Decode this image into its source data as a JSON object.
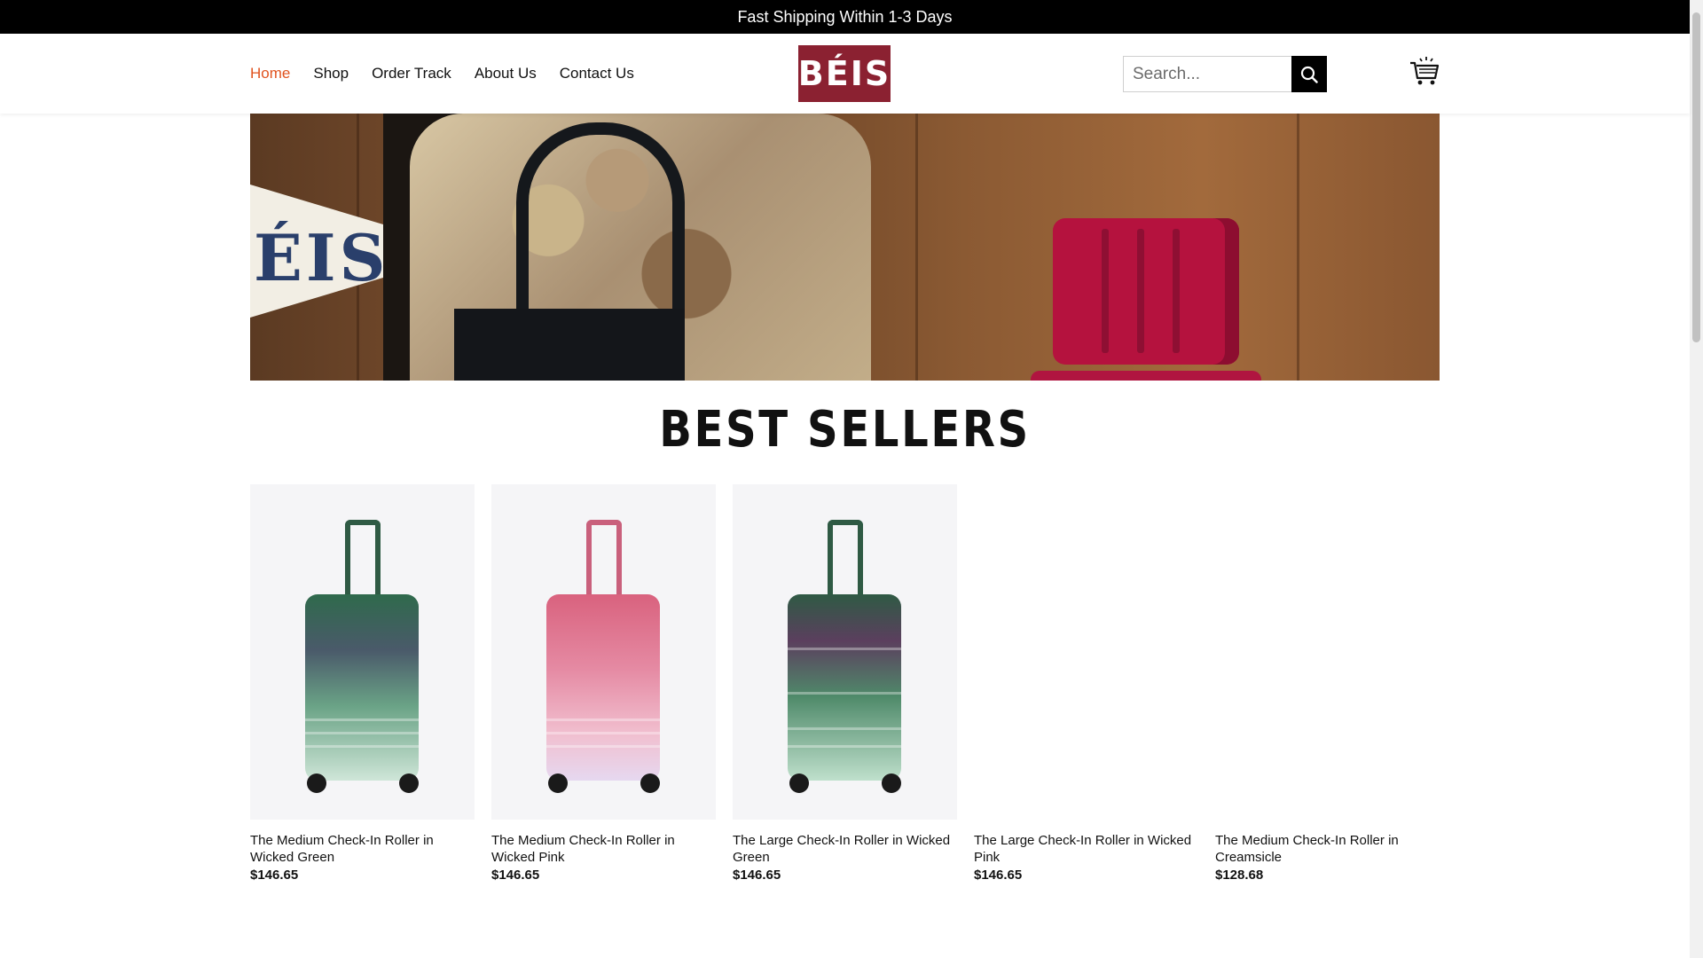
{
  "topbar": {
    "text": "Fast Shipping Within 1-3 Days"
  },
  "nav": {
    "items": [
      {
        "label": "Home",
        "active": true
      },
      {
        "label": "Shop"
      },
      {
        "label": "Order Track"
      },
      {
        "label": "About Us"
      },
      {
        "label": "Contact Us"
      }
    ]
  },
  "logo": {
    "text": "BÉIS",
    "bg_color": "#8b2131"
  },
  "search": {
    "placeholder": "Search..."
  },
  "hero": {
    "pennant_text": "ÉIS"
  },
  "section": {
    "title": "BEST SELLERS"
  },
  "products": [
    {
      "name": "The Medium Check-In Roller in Wicked Green",
      "price": "$146.65",
      "color": "green",
      "shows_image": true
    },
    {
      "name": "The Medium Check-In Roller in Wicked Pink",
      "price": "$146.65",
      "color": "pink",
      "shows_image": true
    },
    {
      "name": "The Large Check-In Roller in Wicked Green",
      "price": "$146.65",
      "color": "green-purple",
      "shows_image": true
    },
    {
      "name": "The Large Check-In Roller in Wicked Pink",
      "price": "$146.65",
      "shows_image": false
    },
    {
      "name": "The Medium Check-In Roller in Creamsicle",
      "price": "$128.68",
      "shows_image": false
    }
  ],
  "colors": {
    "accent": "#e0531f",
    "brand": "#8b2131"
  },
  "icons": [
    "search-icon",
    "cart-icon"
  ]
}
